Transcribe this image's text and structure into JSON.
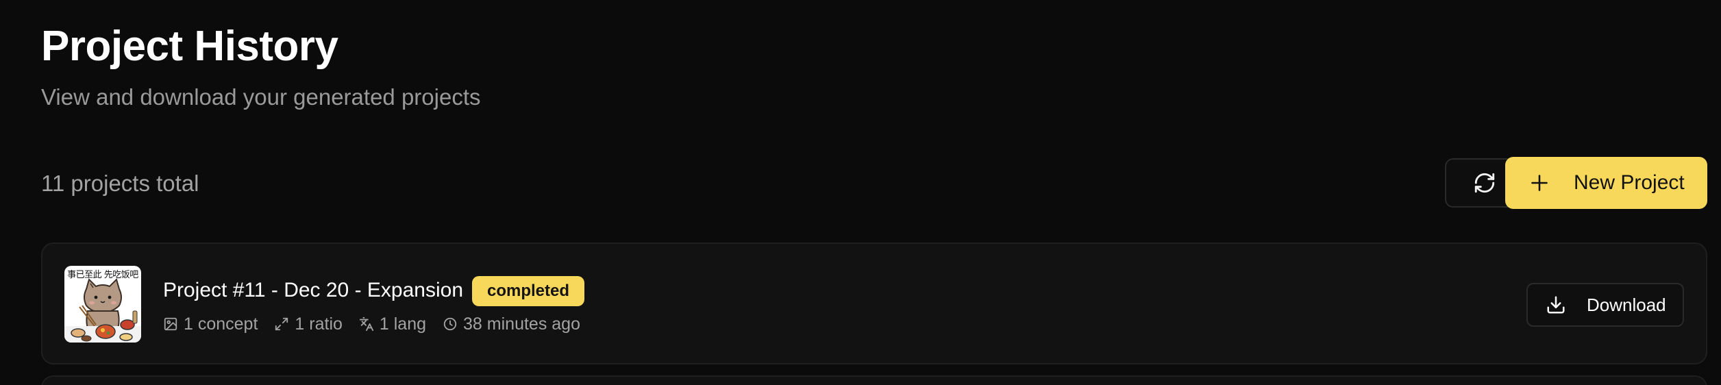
{
  "header": {
    "title": "Project History",
    "subtitle": "View and download your generated projects"
  },
  "toolbar": {
    "total_label": "11 projects total",
    "refresh_icon": "refresh-icon",
    "new_project_label": "New Project",
    "new_project_icon": "plus-icon"
  },
  "projects": [
    {
      "title": "Project #11 - Dec 20 - Expansion",
      "status": "completed",
      "thumbnail_caption": "事已至此 先吃饭吧",
      "meta": {
        "concepts": "1 concept",
        "ratios": "1 ratio",
        "langs": "1 lang",
        "time": "38 minutes ago"
      },
      "download_label": "Download"
    }
  ],
  "colors": {
    "background": "#0b0b0b",
    "card": "#121212",
    "accent": "#f8d85a",
    "muted_text": "#a3a3a3"
  }
}
